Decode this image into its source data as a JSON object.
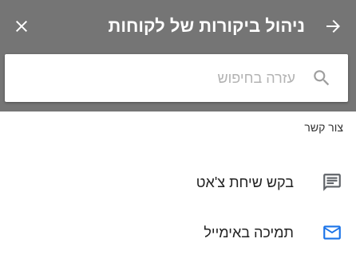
{
  "header": {
    "title": "ניהול ביקורות של לקוחות",
    "back_icon": "arrow-right-icon",
    "close_icon": "close-icon",
    "background_color": "#757575"
  },
  "search": {
    "placeholder": "עזרה בחיפוש",
    "value": "",
    "icon": "search-icon"
  },
  "contact": {
    "section_label": "צור קשר",
    "items": [
      {
        "label": "בקש שיחת צ'אט",
        "icon": "chat-icon",
        "icon_color": "#5f6368"
      },
      {
        "label": "תמיכה באימייל",
        "icon": "email-icon",
        "icon_color": "#1a73e8"
      }
    ]
  }
}
